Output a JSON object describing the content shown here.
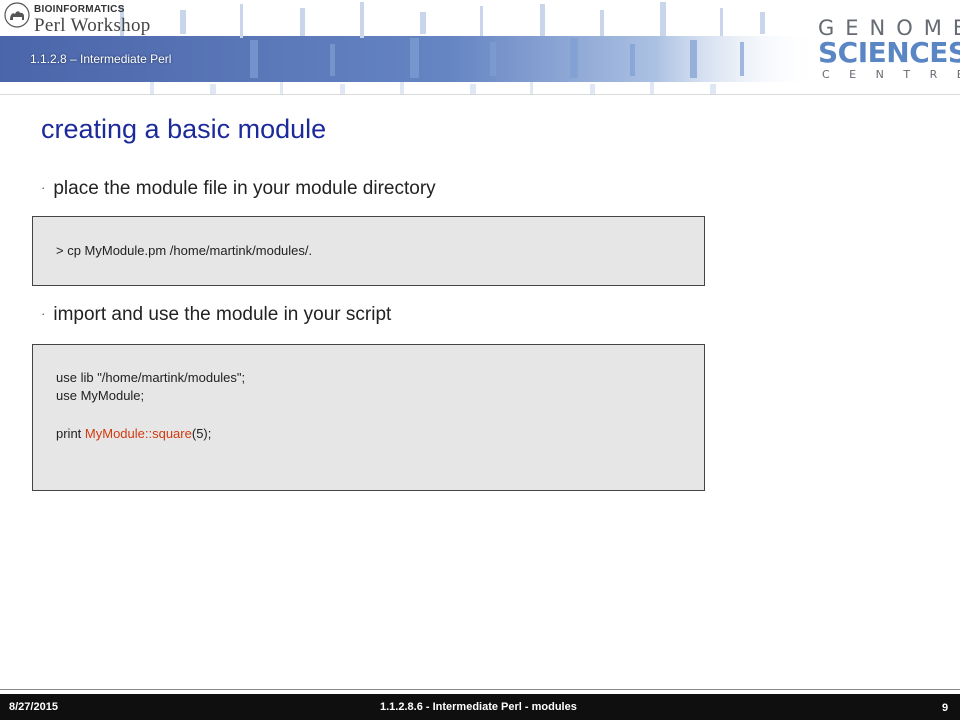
{
  "header": {
    "logo_line1": "BIOINFORMATICS",
    "logo_line2": "Perl Workshop",
    "course": "1.1.2.8 – Intermediate Perl",
    "gsc_top": "GENOME",
    "gsc_mid": "SCIENCES",
    "gsc_bot": "CENTRE"
  },
  "slide": {
    "title": "creating a basic module",
    "bullets": [
      "place the module file in your module directory",
      "import and use the module in your script"
    ],
    "code1": "> cp MyModule.pm /home/martink/modules/.",
    "code2": {
      "line1": "use lib \"/home/martink/modules\";",
      "line2": "use MyModule;",
      "line3_prefix": "print ",
      "line3_call": "MyModule::square",
      "line3_suffix": "(5);"
    }
  },
  "footer": {
    "date": "8/27/2015",
    "center": "1.1.2.8.6 - Intermediate Perl - modules",
    "page": "9"
  },
  "colors": {
    "title": "#1c2a9a",
    "header_blue": "#5b86c4",
    "code_highlight": "#d23a10",
    "footer_bg": "#0f0f0f"
  }
}
